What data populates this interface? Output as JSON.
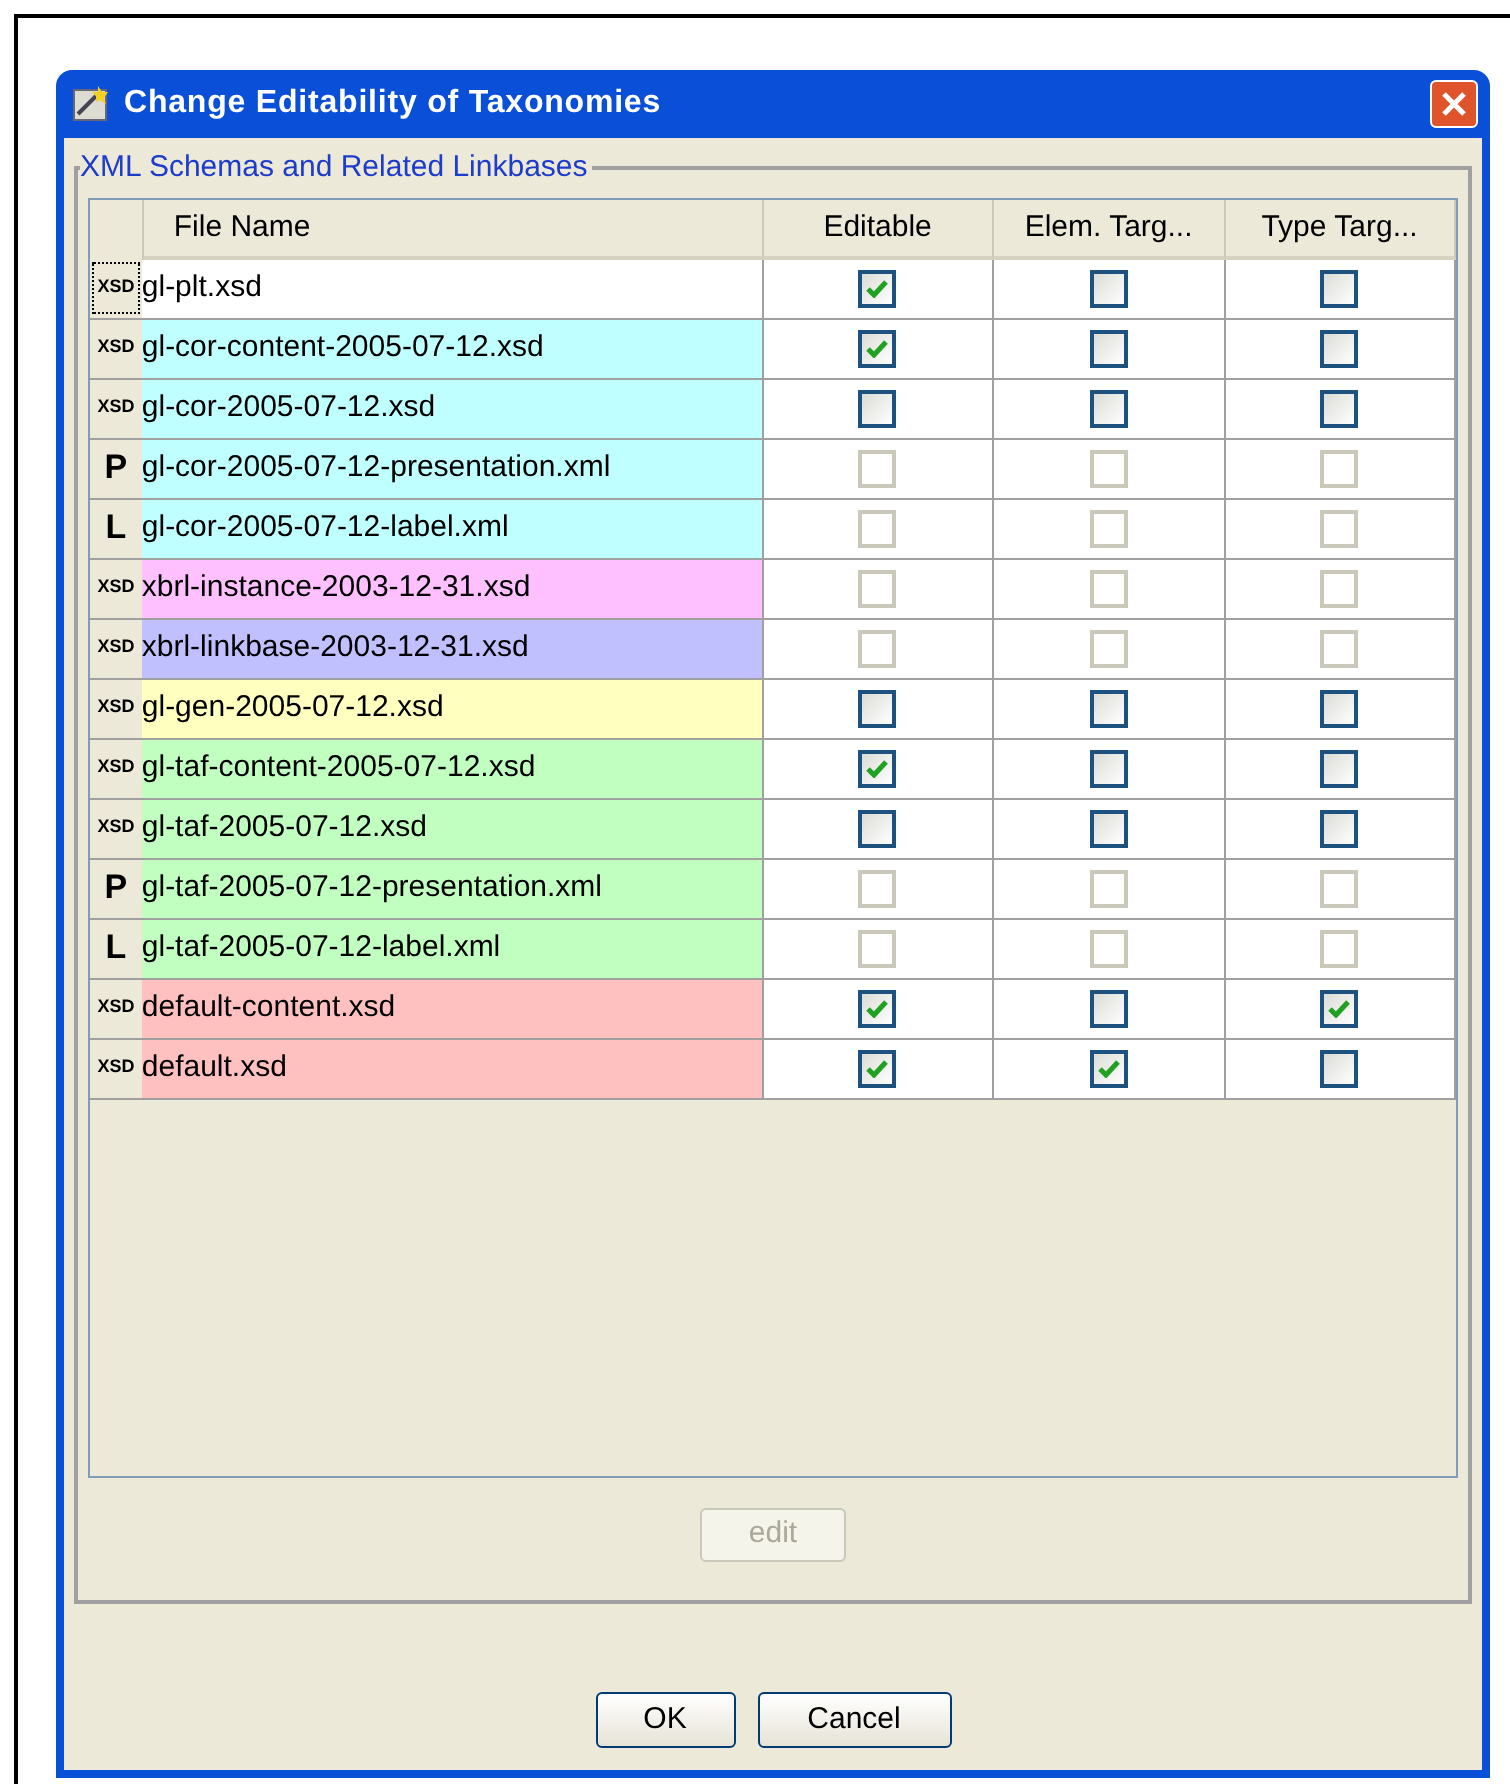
{
  "window": {
    "title": "Change Editability of Taxonomies"
  },
  "group": {
    "title": "XML Schemas and Related Linkbases"
  },
  "table": {
    "columns": [
      "File Name",
      "Editable",
      "Elem. Targ...",
      "Type Targ..."
    ],
    "rows": [
      {
        "icon": "XSD",
        "name": "gl-plt.xsd",
        "color": "#ffffff",
        "selected": true,
        "cells": [
          {
            "checked": true,
            "disabled": false
          },
          {
            "checked": false,
            "disabled": false
          },
          {
            "checked": false,
            "disabled": false
          }
        ]
      },
      {
        "icon": "XSD",
        "name": "gl-cor-content-2005-07-12.xsd",
        "color": "#c0ffff",
        "selected": false,
        "cells": [
          {
            "checked": true,
            "disabled": false
          },
          {
            "checked": false,
            "disabled": false
          },
          {
            "checked": false,
            "disabled": false
          }
        ]
      },
      {
        "icon": "XSD",
        "name": "gl-cor-2005-07-12.xsd",
        "color": "#c0ffff",
        "selected": false,
        "cells": [
          {
            "checked": false,
            "disabled": false
          },
          {
            "checked": false,
            "disabled": false
          },
          {
            "checked": false,
            "disabled": false
          }
        ]
      },
      {
        "icon": "P",
        "name": "gl-cor-2005-07-12-presentation.xml",
        "color": "#c0ffff",
        "selected": false,
        "cells": [
          {
            "checked": false,
            "disabled": true
          },
          {
            "checked": false,
            "disabled": true
          },
          {
            "checked": false,
            "disabled": true
          }
        ]
      },
      {
        "icon": "L",
        "name": "gl-cor-2005-07-12-label.xml",
        "color": "#c0ffff",
        "selected": false,
        "cells": [
          {
            "checked": false,
            "disabled": true
          },
          {
            "checked": false,
            "disabled": true
          },
          {
            "checked": false,
            "disabled": true
          }
        ]
      },
      {
        "icon": "XSD",
        "name": "xbrl-instance-2003-12-31.xsd",
        "color": "#ffc0ff",
        "selected": false,
        "cells": [
          {
            "checked": false,
            "disabled": true
          },
          {
            "checked": false,
            "disabled": true
          },
          {
            "checked": false,
            "disabled": true
          }
        ]
      },
      {
        "icon": "XSD",
        "name": "xbrl-linkbase-2003-12-31.xsd",
        "color": "#c0c0ff",
        "selected": false,
        "cells": [
          {
            "checked": false,
            "disabled": true
          },
          {
            "checked": false,
            "disabled": true
          },
          {
            "checked": false,
            "disabled": true
          }
        ]
      },
      {
        "icon": "XSD",
        "name": "gl-gen-2005-07-12.xsd",
        "color": "#ffffc0",
        "selected": false,
        "cells": [
          {
            "checked": false,
            "disabled": false
          },
          {
            "checked": false,
            "disabled": false
          },
          {
            "checked": false,
            "disabled": false
          }
        ]
      },
      {
        "icon": "XSD",
        "name": "gl-taf-content-2005-07-12.xsd",
        "color": "#c0ffc0",
        "selected": false,
        "cells": [
          {
            "checked": true,
            "disabled": false
          },
          {
            "checked": false,
            "disabled": false
          },
          {
            "checked": false,
            "disabled": false
          }
        ]
      },
      {
        "icon": "XSD",
        "name": "gl-taf-2005-07-12.xsd",
        "color": "#c0ffc0",
        "selected": false,
        "cells": [
          {
            "checked": false,
            "disabled": false
          },
          {
            "checked": false,
            "disabled": false
          },
          {
            "checked": false,
            "disabled": false
          }
        ]
      },
      {
        "icon": "P",
        "name": "gl-taf-2005-07-12-presentation.xml",
        "color": "#c0ffc0",
        "selected": false,
        "cells": [
          {
            "checked": false,
            "disabled": true
          },
          {
            "checked": false,
            "disabled": true
          },
          {
            "checked": false,
            "disabled": true
          }
        ]
      },
      {
        "icon": "L",
        "name": "gl-taf-2005-07-12-label.xml",
        "color": "#c0ffc0",
        "selected": false,
        "cells": [
          {
            "checked": false,
            "disabled": true
          },
          {
            "checked": false,
            "disabled": true
          },
          {
            "checked": false,
            "disabled": true
          }
        ]
      },
      {
        "icon": "XSD",
        "name": "default-content.xsd",
        "color": "#ffc0c0",
        "selected": false,
        "cells": [
          {
            "checked": true,
            "disabled": false
          },
          {
            "checked": false,
            "disabled": false
          },
          {
            "checked": true,
            "disabled": false
          }
        ]
      },
      {
        "icon": "XSD",
        "name": "default.xsd",
        "color": "#ffc0c0",
        "selected": false,
        "cells": [
          {
            "checked": true,
            "disabled": false
          },
          {
            "checked": true,
            "disabled": false
          },
          {
            "checked": false,
            "disabled": false
          }
        ]
      }
    ]
  },
  "edit_button": {
    "label": "edit",
    "disabled": true
  },
  "buttons": [
    "OK",
    "Cancel"
  ]
}
